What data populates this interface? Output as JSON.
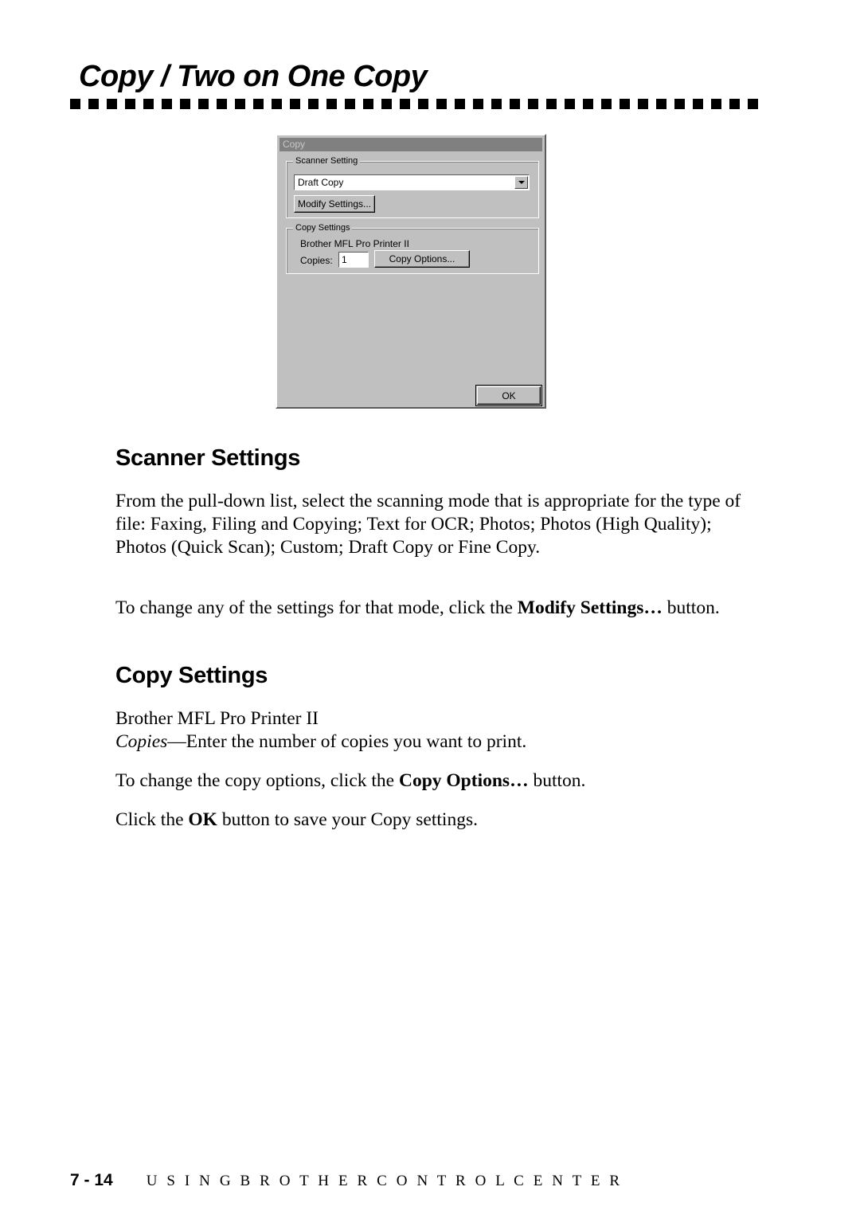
{
  "page": {
    "title": "Copy / Two on One Copy"
  },
  "dialog": {
    "titlebar": "Copy",
    "scanner_group": {
      "label": "Scanner Setting",
      "combo_value": "Draft Copy",
      "modify_button": "Modify Settings..."
    },
    "copy_group": {
      "label": "Copy Settings",
      "printer_name": "Brother MFL Pro Printer II",
      "copies_label": "Copies:",
      "copies_value": "1",
      "copy_options_button": "Copy Options..."
    },
    "ok_button": "OK"
  },
  "sections": {
    "scanner_heading": "Scanner Settings",
    "scanner_paragraph": "From the pull-down list, select the scanning mode that is appropriate for the type of file:  Faxing, Filing and Copying; Text for OCR; Photos; Photos (High Quality); Photos (Quick Scan); Custom; Draft Copy or Fine Copy.",
    "modify_paragraph_before": "To change any of the settings for that mode, click the ",
    "modify_paragraph_bold": "Modify Settings…",
    "modify_paragraph_after": " button.",
    "copy_heading": "Copy Settings",
    "printer_line": "Brother MFL Pro Printer II",
    "copies_italic": "Copies",
    "copies_rest": "—Enter the number of copies you want to print.",
    "options_before": "To change the copy options, click the ",
    "options_bold": "Copy Options…",
    "options_after": " button.",
    "ok_before": "Click the ",
    "ok_bold": "OK",
    "ok_after": " button to save your Copy settings."
  },
  "footer": {
    "folio": "7 - 14",
    "running_title": "U S I N G   B R O T H E R   C O N T R O L   C E N T E R"
  }
}
